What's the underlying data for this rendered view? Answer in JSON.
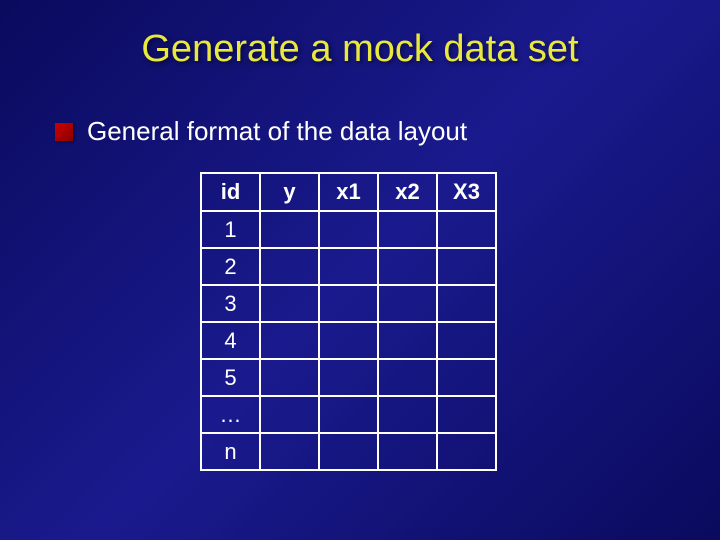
{
  "title": "Generate a mock data set",
  "subtitle": "General format of the data layout",
  "table": {
    "headers": [
      "id",
      "y",
      "x1",
      "x2",
      "X3"
    ],
    "rows": [
      [
        "1",
        "",
        "",
        "",
        ""
      ],
      [
        "2",
        "",
        "",
        "",
        ""
      ],
      [
        "3",
        "",
        "",
        "",
        ""
      ],
      [
        "4",
        "",
        "",
        "",
        ""
      ],
      [
        "5",
        "",
        "",
        "",
        ""
      ],
      [
        "…",
        "",
        "",
        "",
        ""
      ],
      [
        "n",
        "",
        "",
        "",
        ""
      ]
    ]
  }
}
